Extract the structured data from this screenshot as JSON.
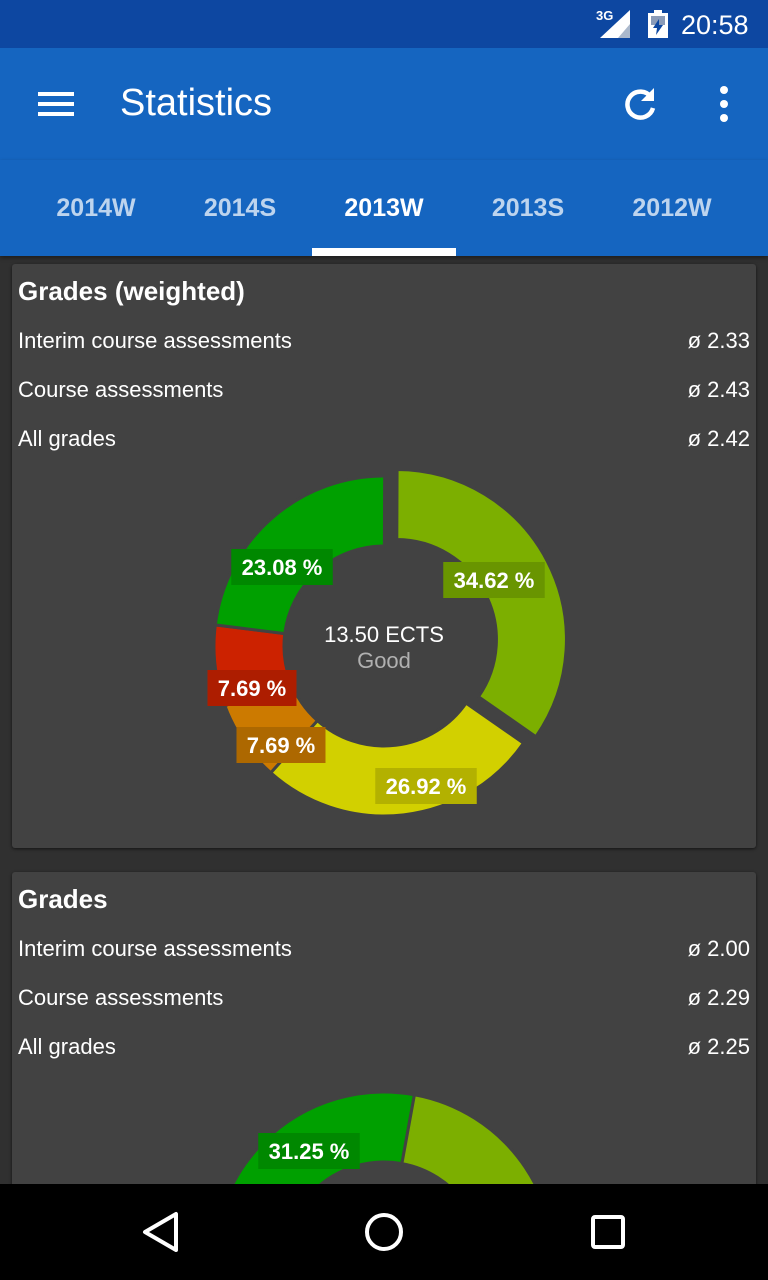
{
  "status_bar": {
    "network": "3G",
    "time": "20:58"
  },
  "app_bar": {
    "title": "Statistics"
  },
  "tabs": [
    {
      "label": "2014W",
      "active": false
    },
    {
      "label": "2014S",
      "active": false
    },
    {
      "label": "2013W",
      "active": true
    },
    {
      "label": "2013S",
      "active": false
    },
    {
      "label": "2012W",
      "active": false
    }
  ],
  "cards": [
    {
      "title": "Grades (weighted)",
      "rows": [
        {
          "label": "Interim course assessments",
          "value": "ø 2.33"
        },
        {
          "label": "Course assessments",
          "value": "ø 2.43"
        },
        {
          "label": "All grades",
          "value": "ø 2.42"
        }
      ],
      "center_primary": "13.50 ECTS",
      "center_secondary": "Good"
    },
    {
      "title": "Grades",
      "rows": [
        {
          "label": "Interim course assessments",
          "value": "ø 2.00"
        },
        {
          "label": "Course assessments",
          "value": "ø 2.29"
        },
        {
          "label": "All grades",
          "value": "ø 2.25"
        }
      ]
    }
  ],
  "colors": {
    "app_bar": "#1565c0",
    "status_bar": "#0d47a1",
    "grade_1": "#7caf00",
    "grade_2": "#00a000",
    "grade_3": "#d2d000",
    "grade_4": "#cc7a00",
    "grade_5": "#cc2200"
  },
  "chart_data": [
    {
      "type": "pie",
      "title": "",
      "center_text": [
        "13.50 ECTS",
        "Good"
      ],
      "slices": [
        {
          "value": 34.62,
          "label": "34.62 %",
          "color": "#7caf00"
        },
        {
          "value": 26.92,
          "label": "26.92 %",
          "color": "#d2d000"
        },
        {
          "value": 7.69,
          "label": "7.69 %",
          "color": "#cc7a00"
        },
        {
          "value": 7.69,
          "label": "7.69 %",
          "color": "#cc2200"
        },
        {
          "value": 23.08,
          "label": "23.08 %",
          "color": "#00a000"
        }
      ]
    },
    {
      "type": "pie",
      "title": "",
      "partially_visible": true,
      "slices": [
        {
          "value": 31.25,
          "label": "31.25 %",
          "color": "#00a000"
        }
      ]
    }
  ]
}
